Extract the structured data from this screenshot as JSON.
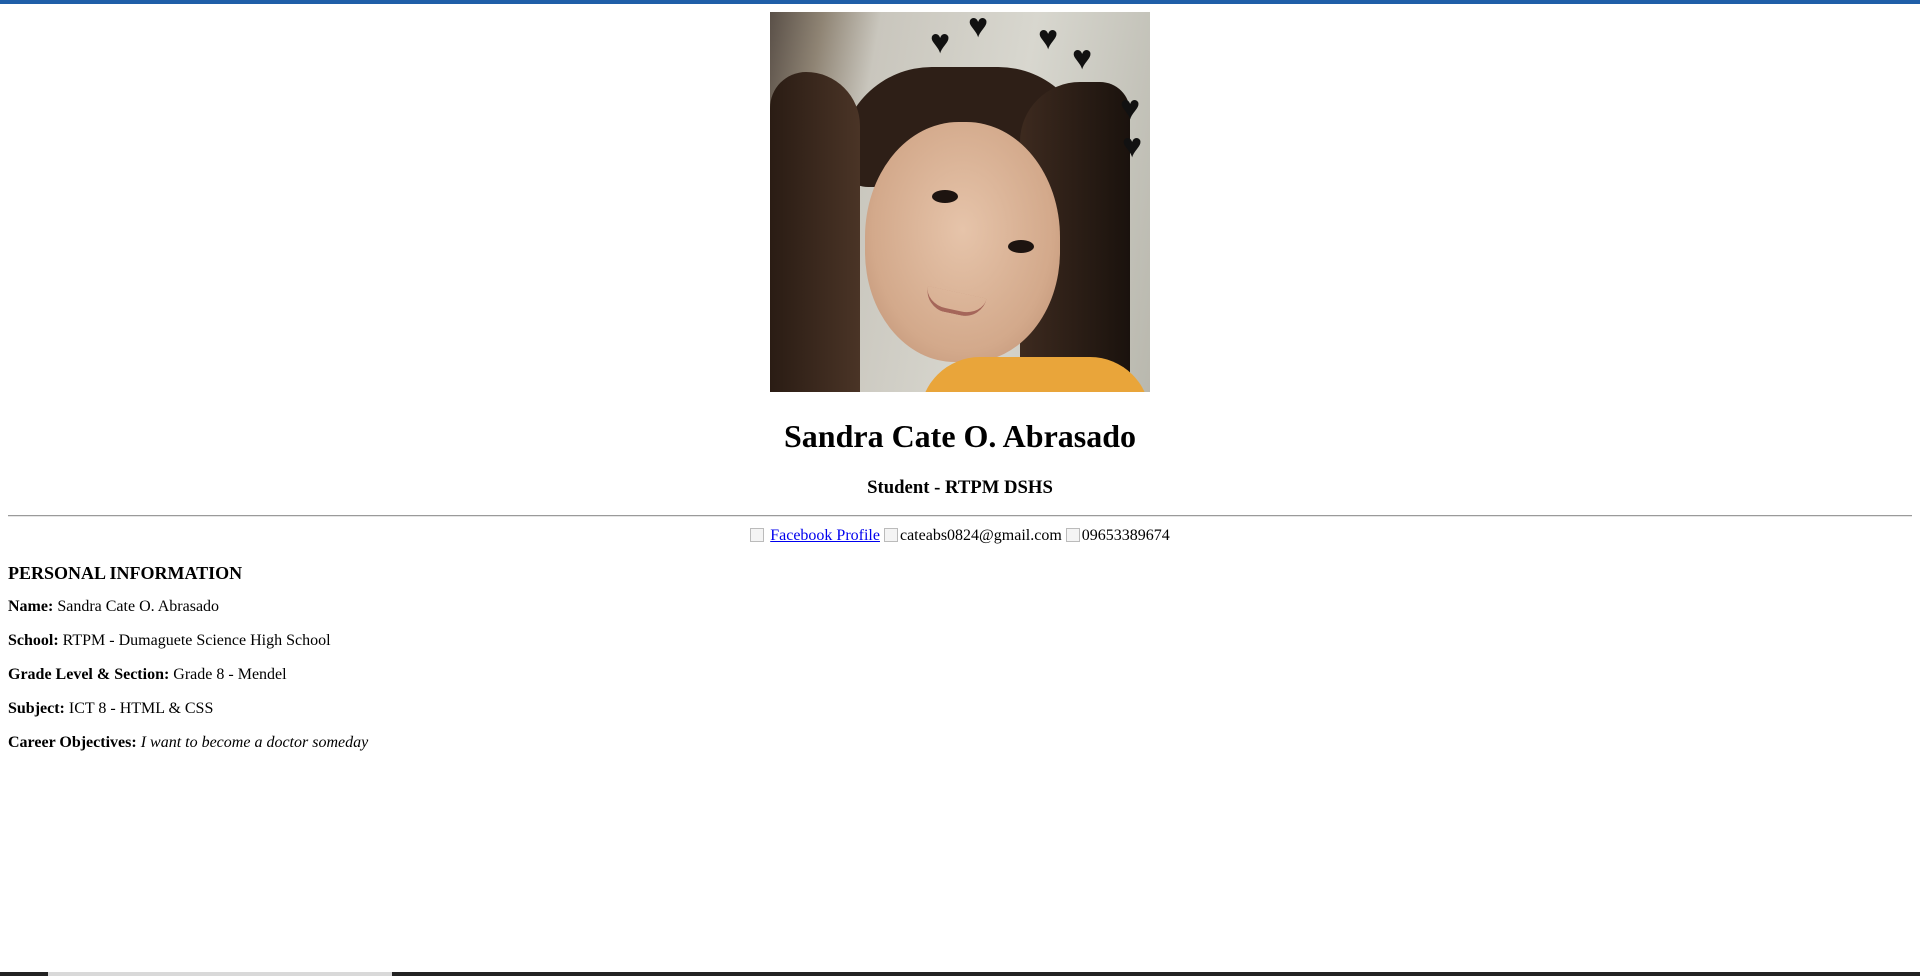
{
  "profile": {
    "photo_alt": "profile-photo",
    "name": "Sandra Cate O. Abrasado",
    "role": "Student - RTPM DSHS"
  },
  "contact": {
    "facebook_label": "Facebook Profile",
    "email": "cateabs0824@gmail.com",
    "phone": "09653389674"
  },
  "personal_info": {
    "heading": "PERSONAL INFORMATION",
    "rows": [
      {
        "label": "Name:",
        "value": "Sandra Cate O. Abrasado"
      },
      {
        "label": "School:",
        "value": "RTPM - Dumaguete Science High School"
      },
      {
        "label": "Grade Level & Section:",
        "value": "Grade 8 - Mendel"
      },
      {
        "label": "Subject:",
        "value": "ICT 8 - HTML & CSS"
      },
      {
        "label": "Career Objectives:",
        "value": "I want to become a doctor someday"
      }
    ]
  },
  "colors": {
    "top_bar": "#1f5fa8",
    "link": "#0000ee"
  }
}
